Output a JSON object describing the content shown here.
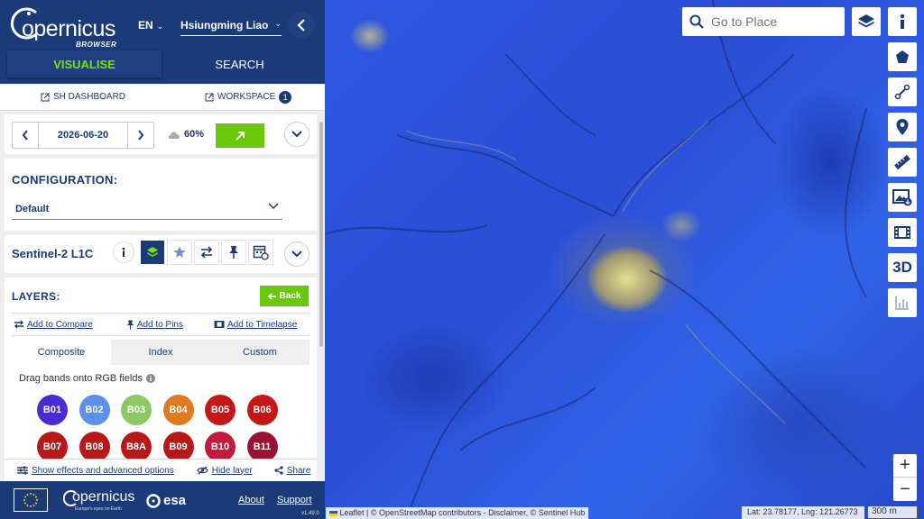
{
  "header": {
    "logo_text": "opernicus",
    "logo_sub": "BROWSER",
    "language": "EN",
    "user": "Hsiungming Liao",
    "tabs": {
      "visualise": "VISUALISE",
      "search": "SEARCH"
    }
  },
  "links": {
    "sh_dashboard": "SH DASHBOARD",
    "workspace": "WORKSPACE",
    "workspace_count": "1"
  },
  "date_panel": {
    "date": "2026-06-20",
    "cloud_cover": "60%"
  },
  "configuration": {
    "title": "CONFIGURATION:",
    "selected": "Default"
  },
  "datasource": {
    "name": "Sentinel-2 L1C"
  },
  "layers": {
    "title": "LAYERS:",
    "back_label": "Back",
    "actions": {
      "compare": "Add to Compare",
      "pins": "Add to Pins",
      "timelapse": "Add to Timelapse"
    },
    "view_tabs": [
      "Composite",
      "Index",
      "Custom"
    ],
    "drag_hint": "Drag bands onto RGB fields",
    "bands": [
      {
        "label": "B01",
        "color": "#4a2bd1"
      },
      {
        "label": "B02",
        "color": "#5f8fe8"
      },
      {
        "label": "B03",
        "color": "#8cc866"
      },
      {
        "label": "B04",
        "color": "#e07a1e"
      },
      {
        "label": "B05",
        "color": "#c41818"
      },
      {
        "label": "B06",
        "color": "#c41818"
      },
      {
        "label": "B07",
        "color": "#b81818"
      },
      {
        "label": "B08",
        "color": "#b81818"
      },
      {
        "label": "B8A",
        "color": "#b81818"
      },
      {
        "label": "B09",
        "color": "#b81818"
      },
      {
        "label": "B10",
        "color": "#c21a3c"
      },
      {
        "label": "B11",
        "color": "#9a1232"
      }
    ]
  },
  "effects_bar": {
    "effects": "Show effects and advanced options",
    "hide": "Hide layer",
    "share": "Share"
  },
  "footer": {
    "logo_text": "opernicus",
    "logo_sub": "Europe's eyes on Earth",
    "esa": "esa",
    "about": "About",
    "support": "Support",
    "version": "v1.49.0"
  },
  "map": {
    "search_placeholder": "Go to Place",
    "attribution": "Leaflet | © OpenStreetMap contributors - Disclaimer, © Sentinel Hub",
    "coords": "Lat: 23.78177, Lng: 121.26773",
    "scale": "300 m",
    "tool_3d": "3D",
    "zoom_in": "+",
    "zoom_out": "−"
  },
  "colors": {
    "brand": "#1b3a78",
    "accent": "#69c80a",
    "vis_tab_text": "#7de00a"
  }
}
